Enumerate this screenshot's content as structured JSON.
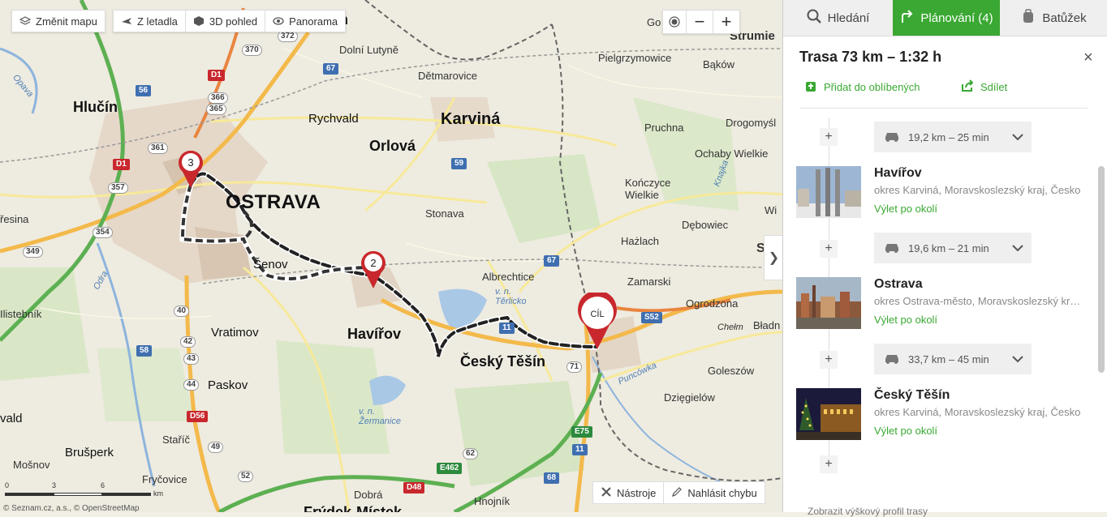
{
  "map": {
    "toolbar": {
      "change_map": "Změnit mapu",
      "aerial": "Z letadla",
      "view3d": "3D pohled",
      "panorama": "Panorama"
    },
    "zoom": {
      "out": "−",
      "in": "+"
    },
    "bottom_tools": {
      "tools": "Nástroje",
      "report": "Nahlásit chybu"
    },
    "collapse_icon": "❯",
    "scale": {
      "a": "0",
      "b": "3",
      "c": "6",
      "unit": "km"
    },
    "copyright": "© Seznam.cz, a.s., © OpenStreetMap",
    "pins": {
      "p3": "3",
      "p2": "2",
      "end": "CÍL"
    },
    "labels": {
      "ostrava": "OSTRAVA",
      "karvina": "Karviná",
      "orlova": "Orlová",
      "havirov": "Havířov",
      "ceskytesin": "Český Těšín",
      "hlucin": "Hlučín",
      "rychvald": "Rychvald",
      "senov": "Šenov",
      "vratimov": "Vratimov",
      "paskov": "Paskov",
      "brusperk": "Brušperk",
      "staric": "Staříč",
      "frycovice": "Fryčovice",
      "mosnov": "Mošnov",
      "dobra": "Dobrá",
      "hnojnik": "Hnojník",
      "stonava": "Stonava",
      "albrechtice": "Albrechtice",
      "dolni_lutyne": "Dolní Lutyně",
      "detmarovice": "Dětmarovice",
      "pruchna": "Pruchna",
      "konczyce": "Kończyce\nWielkie",
      "hazlach": "Hażlach",
      "zamarski": "Zamarski",
      "ogrodzona": "Ogrodzona",
      "debowiec": "Dębowiec",
      "goleszow": "Goleszów",
      "dziegielow": "Dzięgielów",
      "pielgrzymowice": "Pielgrzymowice",
      "bakow": "Bąków",
      "drogomysl": "Drogomyśl",
      "ochaby": "Ochaby Wielkie",
      "strumien": "Strumie",
      "chelm": "Chełm",
      "bladn": "Bładn",
      "frydek": "Frýdek-Místek",
      "go": "Go",
      "wi": "Wi",
      "s": "S",
      "resina": "řesina",
      "istebnik": "Ilistebník",
      "vald": "vald",
      "n": "n",
      "terlicko": "v. n.\nTěrlicko",
      "zermanice": "v. n.\nŽermanice",
      "odra": "Odra",
      "opava": "Opava",
      "puncowka": "Puncówka",
      "knajka": "Knajka"
    },
    "shields": {
      "d1a": "D1",
      "d1b": "D1",
      "d56": "D56",
      "d48": "D48",
      "r56": "56",
      "r58": "58",
      "r67a": "67",
      "r67b": "67",
      "r59": "59",
      "r11a": "11",
      "r11b": "11",
      "r68": "68",
      "e75": "E75",
      "e462": "E462",
      "s52": "S52",
      "n370": "370",
      "n372": "372",
      "n366": "366",
      "n365": "365",
      "n361": "361",
      "n357": "357",
      "n354": "354",
      "n349": "349",
      "n40": "40",
      "n42": "42",
      "n43": "43",
      "n44": "44",
      "n49": "49",
      "n52": "52",
      "n62": "62",
      "n71": "71"
    }
  },
  "panel": {
    "tabs": [
      {
        "label": "Hledání"
      },
      {
        "label": "Plánování (4)"
      },
      {
        "label": "Batůžek"
      }
    ],
    "route_title": "Trasa 73 km – 1:32 h",
    "close": "×",
    "favorite": "Přidat do oblíbených",
    "share": "Sdílet",
    "segments": [
      {
        "text": "19,2 km – 25 min"
      },
      {
        "text": "19,6 km – 21 min"
      },
      {
        "text": "33,7 km – 45 min"
      }
    ],
    "stops": [
      {
        "name": "Havířov",
        "sub": "okres Karviná, Moravskoslezský kraj, Česko",
        "trip": "Výlet po okolí"
      },
      {
        "name": "Ostrava",
        "sub": "okres Ostrava-město, Moravskoslezský kraj, Česko",
        "trip": "Výlet po okolí"
      },
      {
        "name": "Český Těšín",
        "sub": "okres Karviná, Moravskoslezský kraj, Česko",
        "trip": "Výlet po okolí"
      }
    ],
    "profile": "Zobrazit výškový profil trasy"
  },
  "colors": {
    "accent": "#3aa832",
    "pin_red": "#c8282d"
  }
}
